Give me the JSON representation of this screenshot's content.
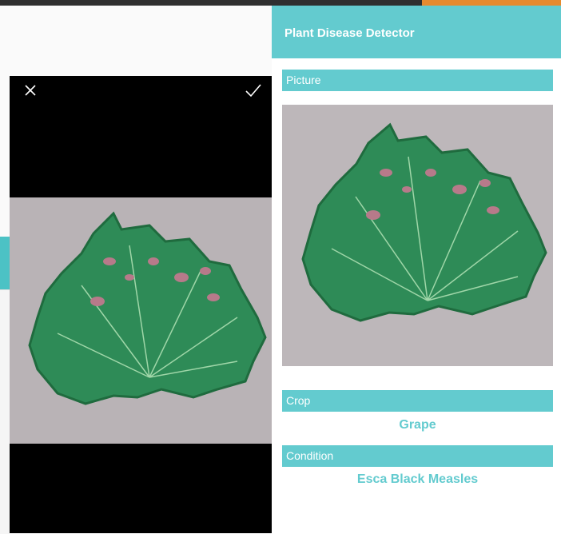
{
  "status_bar": {
    "accent_color": "#e68a2e"
  },
  "camera": {
    "close_icon": "close-icon",
    "confirm_icon": "checkmark-icon",
    "background": "#000000"
  },
  "app": {
    "title": "Plant Disease Detector",
    "accent_color": "#63cbcf",
    "sections": {
      "picture_label": "Picture",
      "crop_label": "Crop",
      "crop_value": "Grape",
      "condition_label": "Condition",
      "condition_value": "Esca Black Measles"
    }
  }
}
